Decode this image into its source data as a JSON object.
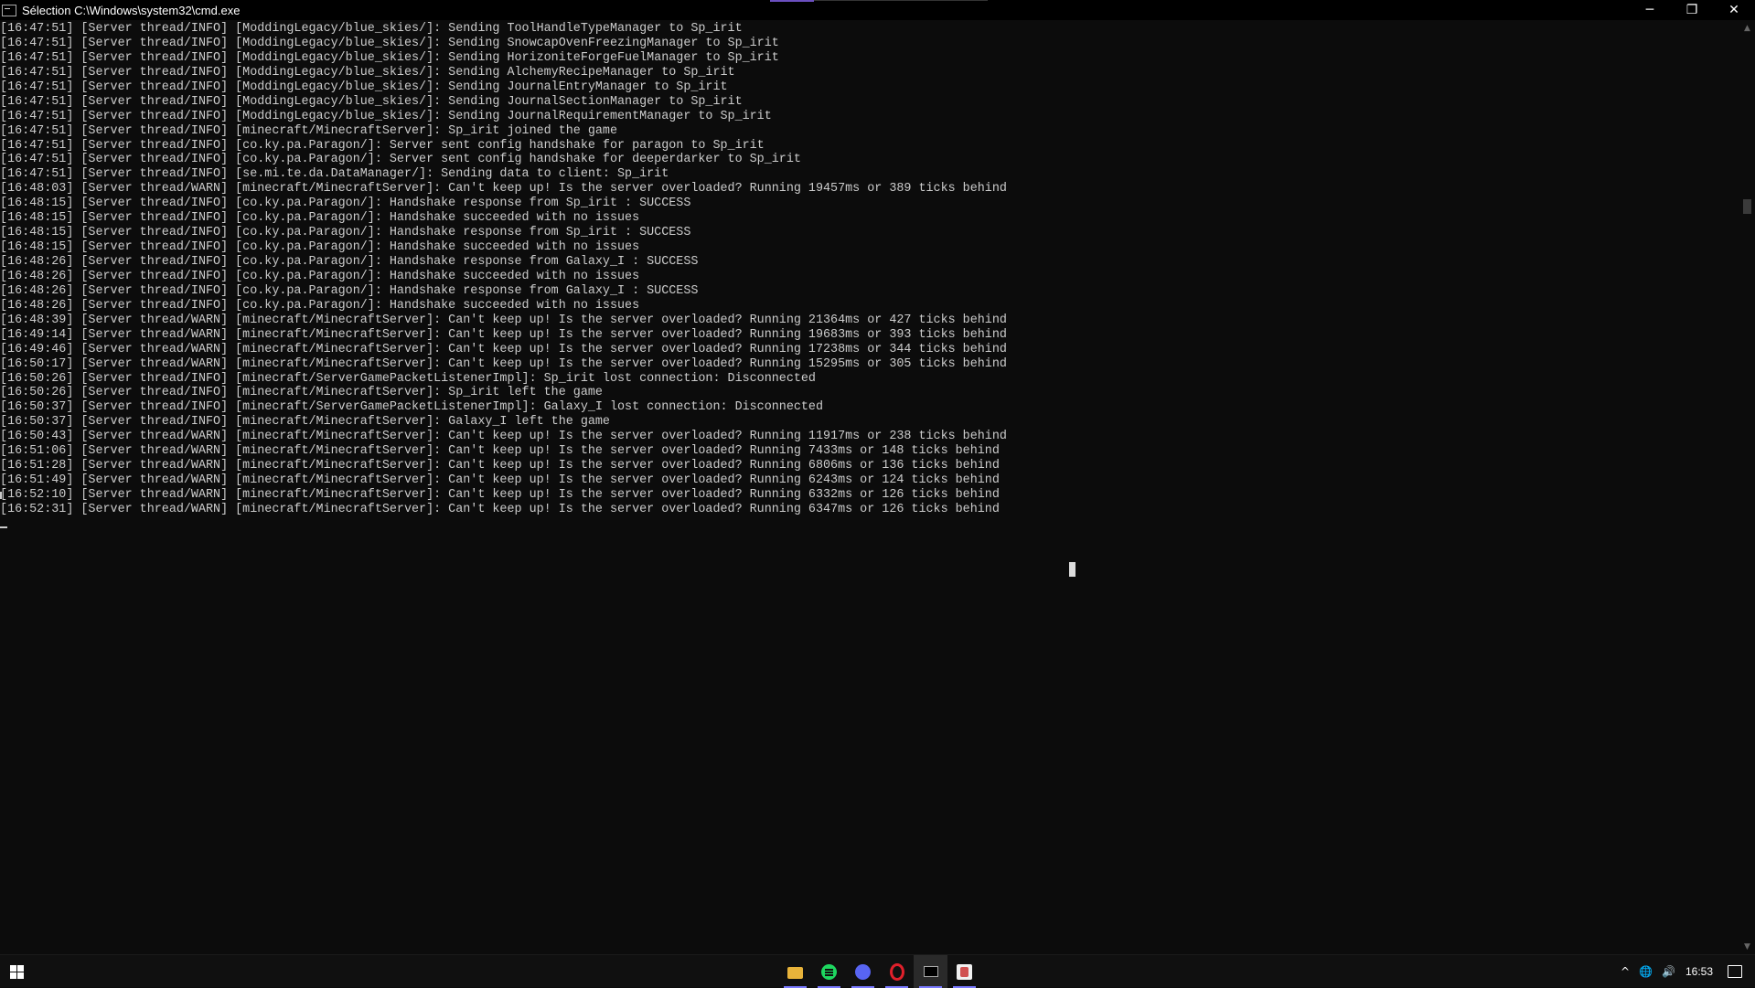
{
  "window": {
    "title": "Sélection C:\\Windows\\system32\\cmd.exe",
    "minimize": "─",
    "restore": "❐",
    "close": "✕"
  },
  "console": {
    "lines": [
      "[16:47:51] [Server thread/INFO] [ModdingLegacy/blue_skies/]: Sending ToolHandleTypeManager to Sp_irit",
      "[16:47:51] [Server thread/INFO] [ModdingLegacy/blue_skies/]: Sending SnowcapOvenFreezingManager to Sp_irit",
      "[16:47:51] [Server thread/INFO] [ModdingLegacy/blue_skies/]: Sending HorizoniteForgeFuelManager to Sp_irit",
      "[16:47:51] [Server thread/INFO] [ModdingLegacy/blue_skies/]: Sending AlchemyRecipeManager to Sp_irit",
      "[16:47:51] [Server thread/INFO] [ModdingLegacy/blue_skies/]: Sending JournalEntryManager to Sp_irit",
      "[16:47:51] [Server thread/INFO] [ModdingLegacy/blue_skies/]: Sending JournalSectionManager to Sp_irit",
      "[16:47:51] [Server thread/INFO] [ModdingLegacy/blue_skies/]: Sending JournalRequirementManager to Sp_irit",
      "[16:47:51] [Server thread/INFO] [minecraft/MinecraftServer]: Sp_irit joined the game",
      "[16:47:51] [Server thread/INFO] [co.ky.pa.Paragon/]: Server sent config handshake for paragon to Sp_irit",
      "[16:47:51] [Server thread/INFO] [co.ky.pa.Paragon/]: Server sent config handshake for deeperdarker to Sp_irit",
      "[16:47:51] [Server thread/INFO] [se.mi.te.da.DataManager/]: Sending data to client: Sp_irit",
      "[16:48:03] [Server thread/WARN] [minecraft/MinecraftServer]: Can't keep up! Is the server overloaded? Running 19457ms or 389 ticks behind",
      "[16:48:15] [Server thread/INFO] [co.ky.pa.Paragon/]: Handshake response from Sp_irit : SUCCESS",
      "[16:48:15] [Server thread/INFO] [co.ky.pa.Paragon/]: Handshake succeeded with no issues",
      "[16:48:15] [Server thread/INFO] [co.ky.pa.Paragon/]: Handshake response from Sp_irit : SUCCESS",
      "[16:48:15] [Server thread/INFO] [co.ky.pa.Paragon/]: Handshake succeeded with no issues",
      "[16:48:26] [Server thread/INFO] [co.ky.pa.Paragon/]: Handshake response from Galaxy_I : SUCCESS",
      "[16:48:26] [Server thread/INFO] [co.ky.pa.Paragon/]: Handshake succeeded with no issues",
      "[16:48:26] [Server thread/INFO] [co.ky.pa.Paragon/]: Handshake response from Galaxy_I : SUCCESS",
      "[16:48:26] [Server thread/INFO] [co.ky.pa.Paragon/]: Handshake succeeded with no issues",
      "[16:48:39] [Server thread/WARN] [minecraft/MinecraftServer]: Can't keep up! Is the server overloaded? Running 21364ms or 427 ticks behind",
      "[16:49:14] [Server thread/WARN] [minecraft/MinecraftServer]: Can't keep up! Is the server overloaded? Running 19683ms or 393 ticks behind",
      "[16:49:46] [Server thread/WARN] [minecraft/MinecraftServer]: Can't keep up! Is the server overloaded? Running 17238ms or 344 ticks behind",
      "[16:50:17] [Server thread/WARN] [minecraft/MinecraftServer]: Can't keep up! Is the server overloaded? Running 15295ms or 305 ticks behind",
      "[16:50:26] [Server thread/INFO] [minecraft/ServerGamePacketListenerImpl]: Sp_irit lost connection: Disconnected",
      "[16:50:26] [Server thread/INFO] [minecraft/MinecraftServer]: Sp_irit left the game",
      "[16:50:37] [Server thread/INFO] [minecraft/ServerGamePacketListenerImpl]: Galaxy_I lost connection: Disconnected",
      "[16:50:37] [Server thread/INFO] [minecraft/MinecraftServer]: Galaxy_I left the game",
      "[16:50:43] [Server thread/WARN] [minecraft/MinecraftServer]: Can't keep up! Is the server overloaded? Running 11917ms or 238 ticks behind",
      "[16:51:06] [Server thread/WARN] [minecraft/MinecraftServer]: Can't keep up! Is the server overloaded? Running 7433ms or 148 ticks behind",
      "[16:51:28] [Server thread/WARN] [minecraft/MinecraftServer]: Can't keep up! Is the server overloaded? Running 6806ms or 136 ticks behind",
      "[16:51:49] [Server thread/WARN] [minecraft/MinecraftServer]: Can't keep up! Is the server overloaded? Running 6243ms or 124 ticks behind",
      "[16:52:10] [Server thread/WARN] [minecraft/MinecraftServer]: Can't keep up! Is the server overloaded? Running 6332ms or 126 ticks behind",
      "[16:52:31] [Server thread/WARN] [minecraft/MinecraftServer]: Can't keep up! Is the server overloaded? Running 6347ms or 126 ticks behind"
    ]
  },
  "taskbar": {
    "apps": [
      {
        "name": "file-explorer",
        "icon": "folder-icon",
        "active": false
      },
      {
        "name": "spotify",
        "icon": "spotify-icon",
        "active": false
      },
      {
        "name": "discord",
        "icon": "discord-icon",
        "active": false
      },
      {
        "name": "opera",
        "icon": "opera-icon",
        "active": false
      },
      {
        "name": "cmd",
        "icon": "cmd-icon",
        "active": true
      },
      {
        "name": "app",
        "icon": "app6-icon",
        "active": false
      }
    ],
    "tray": {
      "chevron": "^",
      "network": "🌐",
      "volume": "🔊",
      "clock": "16:53"
    }
  },
  "colors": {
    "console_bg": "#0c0c0c",
    "console_text": "#cccccc",
    "accent": "#7a7aff"
  }
}
